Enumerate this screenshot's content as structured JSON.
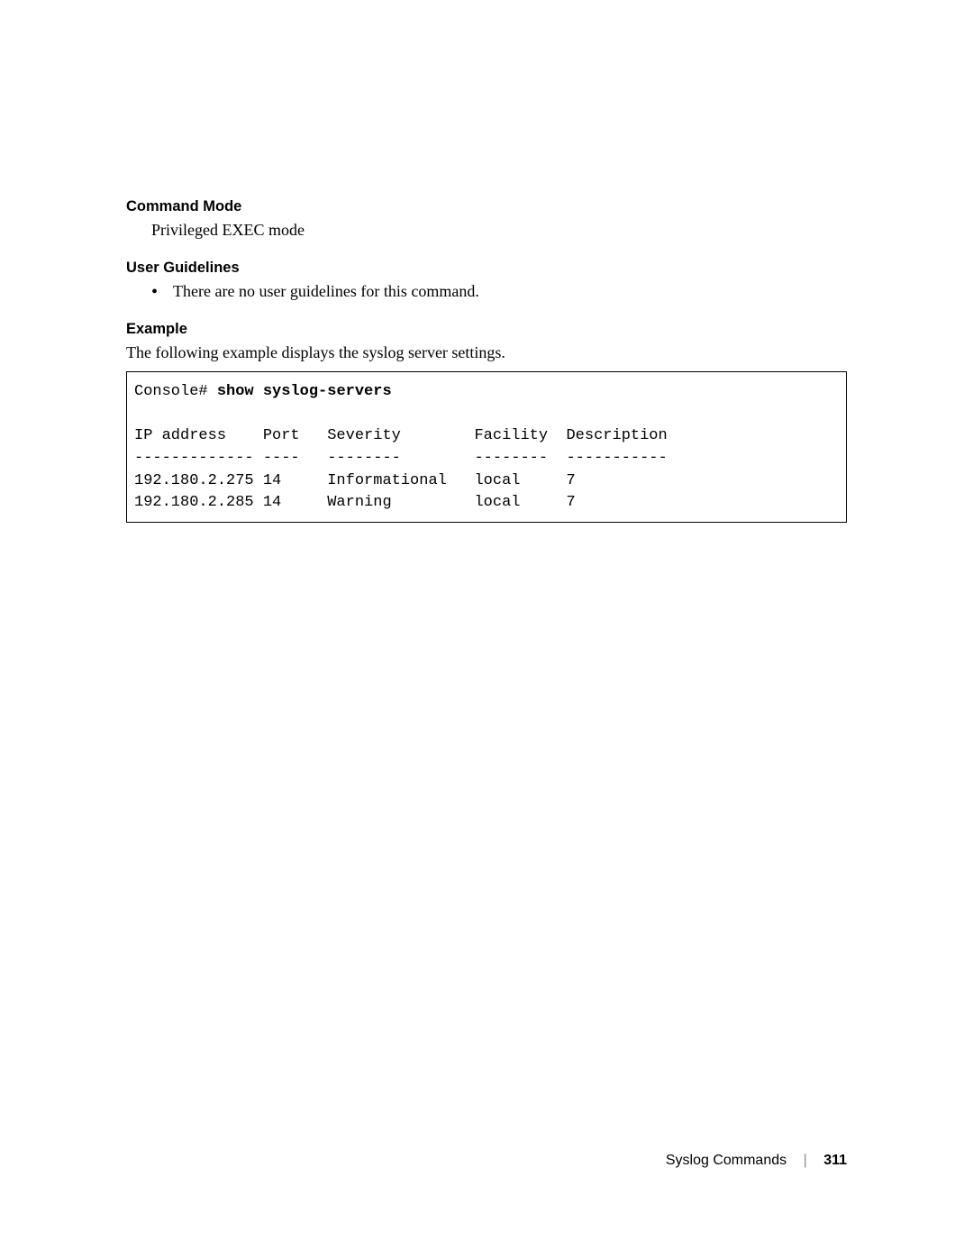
{
  "sections": {
    "command_mode": {
      "heading": "Command Mode",
      "text": "Privileged EXEC mode"
    },
    "user_guidelines": {
      "heading": "User Guidelines",
      "bullet": "There are no user guidelines for this command."
    },
    "example": {
      "heading": "Example",
      "intro": "The following example displays the syslog server settings.",
      "prompt": "Console# ",
      "command": "show syslog-servers",
      "columns_line": "IP address    Port   Severity        Facility  Description",
      "divider_line": "------------- ----   --------        --------  -----------",
      "rows": [
        "192.180.2.275 14     Informational   local     7",
        "192.180.2.285 14     Warning         local     7"
      ]
    }
  },
  "footer": {
    "chapter": "Syslog Commands",
    "page": "311"
  }
}
